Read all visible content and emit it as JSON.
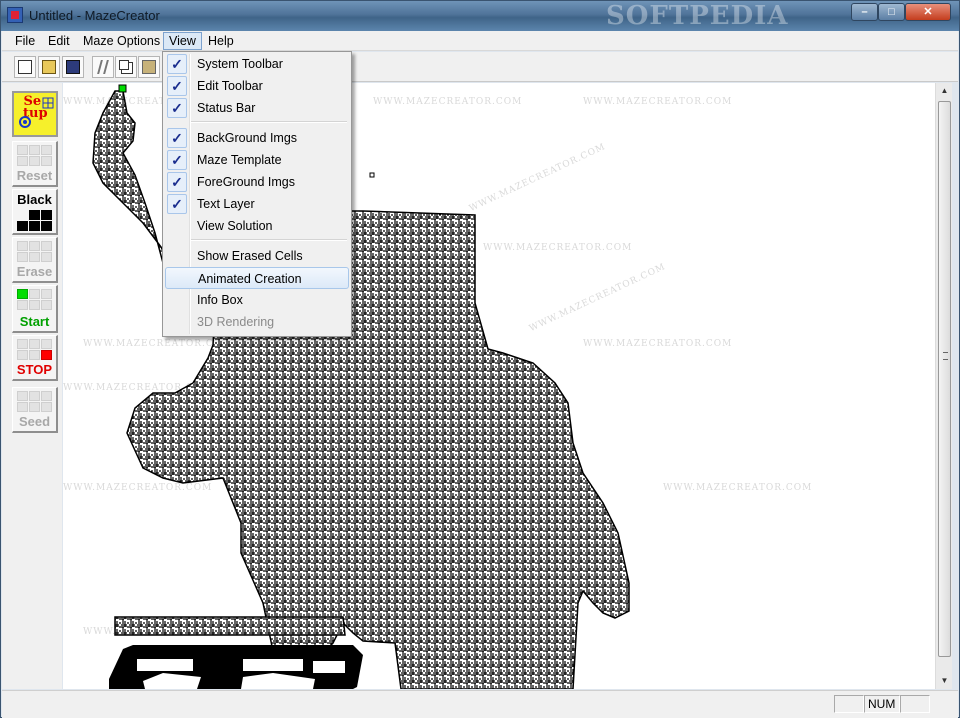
{
  "window": {
    "title": "Untitled - MazeCreator",
    "watermark": "SOFTPEDIA"
  },
  "caption_buttons": {
    "min": "–",
    "max": "□",
    "close": "✕"
  },
  "menubar": {
    "items": [
      "File",
      "Edit",
      "Maze Options",
      "View",
      "Help"
    ],
    "open_item": "View"
  },
  "view_menu": {
    "items": [
      {
        "label": "System Toolbar",
        "checked": true
      },
      {
        "label": "Edit Toolbar",
        "checked": true
      },
      {
        "label": "Status Bar",
        "checked": true
      },
      {
        "label": "BackGround Imgs",
        "checked": true
      },
      {
        "label": "Maze Template",
        "checked": true
      },
      {
        "label": "ForeGround Imgs",
        "checked": true
      },
      {
        "label": "Text Layer",
        "checked": true
      },
      {
        "label": "View Solution",
        "checked": false
      },
      {
        "label": "Show Erased Cells",
        "checked": false
      },
      {
        "label": "Animated Creation",
        "checked": false,
        "highlighted": true
      },
      {
        "label": "Info Box",
        "checked": false
      },
      {
        "label": "3D Rendering",
        "checked": false,
        "disabled": true
      }
    ],
    "check_mark": "✓"
  },
  "toolbar": {
    "icons": [
      "new-file-icon",
      "open-folder-icon",
      "save-icon",
      "cut-icon",
      "copy-icon",
      "paste-icon"
    ]
  },
  "left_panel": {
    "setup": {
      "line1": "Se",
      "line2": "tup"
    },
    "reset": "Reset",
    "black": "Black",
    "erase": "Erase",
    "start": "Start",
    "stop": "STOP",
    "seed": "Seed"
  },
  "canvas": {
    "watermark_text": "WWW.MAZECREATOR.COM"
  },
  "statusbar": {
    "num": "NUM"
  },
  "colors": {
    "maze": "#000000",
    "start_cell": "#00dd00",
    "stop_cell": "#ff0000",
    "setup_bg": "#f6f02b"
  }
}
